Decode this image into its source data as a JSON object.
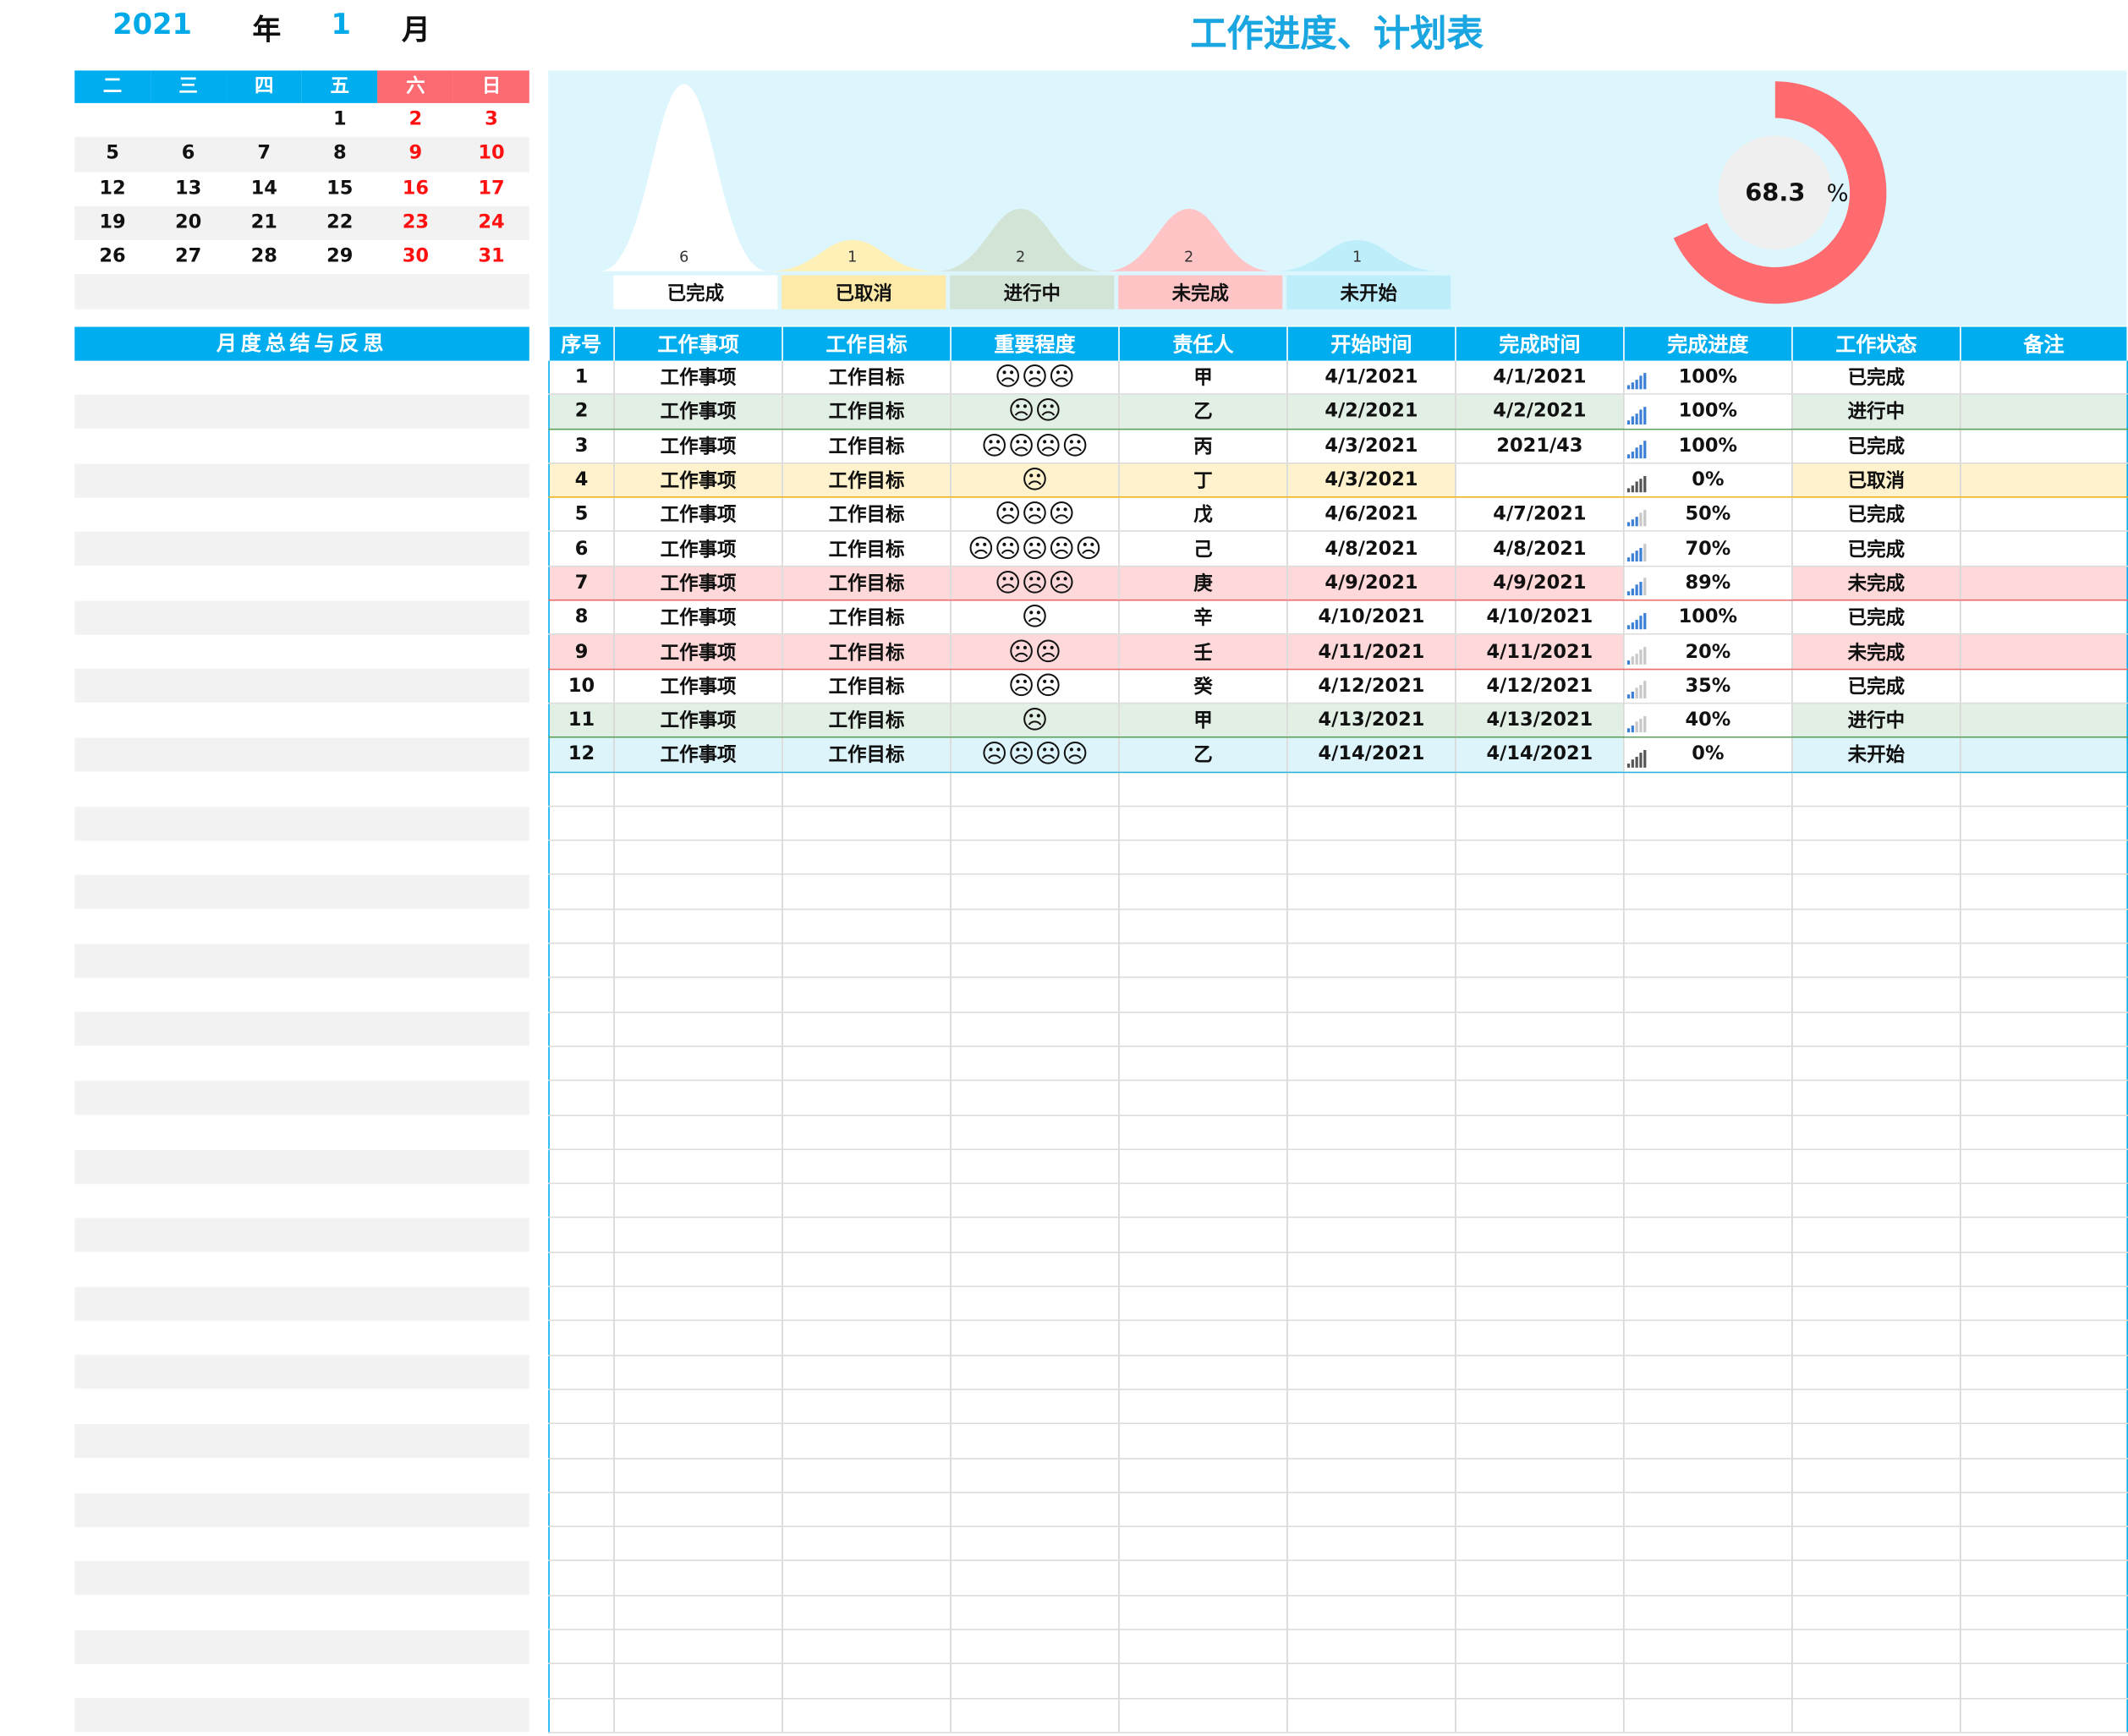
{
  "header": {
    "year": "2021",
    "year_unit": "年",
    "month": "1",
    "month_unit": "月",
    "title": "工作进度、计划表"
  },
  "calendar": {
    "weekdays": [
      "二",
      "三",
      "四",
      "五",
      "六",
      "日"
    ],
    "weeks": [
      [
        "",
        "",
        "",
        "1",
        "2",
        "3"
      ],
      [
        "5",
        "6",
        "7",
        "8",
        "9",
        "10"
      ],
      [
        "12",
        "13",
        "14",
        "15",
        "16",
        "17"
      ],
      [
        "19",
        "20",
        "21",
        "22",
        "23",
        "24"
      ],
      [
        "26",
        "27",
        "28",
        "29",
        "30",
        "31"
      ],
      [
        "",
        "",
        "",
        "",
        "",
        ""
      ]
    ],
    "weekend_color": "#ff1010",
    "header_color": "#00aeef",
    "weekend_header_color": "#fc6a72"
  },
  "summary": {
    "title": "月度总结与反思"
  },
  "dashboard": {
    "statuses": [
      {
        "label": "已完成",
        "count": "6",
        "color": "#ffffff",
        "label_bg": "#ffffff"
      },
      {
        "label": "已取消",
        "count": "1",
        "color": "#fff0b8",
        "label_bg": "#fde9a8"
      },
      {
        "label": "进行中",
        "count": "2",
        "color": "#d2e4d5",
        "label_bg": "#d2e4d5"
      },
      {
        "label": "未完成",
        "count": "2",
        "color": "#ffc4c6",
        "label_bg": "#ffc4c6"
      },
      {
        "label": "未开始",
        "count": "1",
        "color": "#bfeefb",
        "label_bg": "#bfeefb"
      }
    ],
    "completion": {
      "value_text": "68.3",
      "unit": "%",
      "fraction": 0.683,
      "ring_color": "#ff6b6f",
      "hole_color": "#efefef"
    }
  },
  "table": {
    "headers": [
      "序号",
      "工作事项",
      "工作目标",
      "重要程度",
      "责任人",
      "开始时间",
      "完成时间",
      "完成进度",
      "工作状态",
      "备注"
    ],
    "rows": [
      {
        "id": "1",
        "item": "工作事项",
        "goal": "工作目标",
        "importance": "☹☹☹",
        "owner": "甲",
        "start": "4/1/2021",
        "end": "4/1/2021",
        "progress": "100%",
        "progress_value": 1.0,
        "status": "已完成",
        "note": "",
        "row_class": "s-done"
      },
      {
        "id": "2",
        "item": "工作事项",
        "goal": "工作目标",
        "importance": "☹☹",
        "owner": "乙",
        "start": "4/2/2021",
        "end": "4/2/2021",
        "progress": "100%",
        "progress_value": 1.0,
        "status": "进行中",
        "note": "",
        "row_class": "s-prog"
      },
      {
        "id": "3",
        "item": "工作事项",
        "goal": "工作目标",
        "importance": "☹☹☹☹",
        "owner": "丙",
        "start": "4/3/2021",
        "end": "2021/43",
        "progress": "100%",
        "progress_value": 1.0,
        "status": "已完成",
        "note": "",
        "row_class": "s-done"
      },
      {
        "id": "4",
        "item": "工作事项",
        "goal": "工作目标",
        "importance": "☹",
        "owner": "丁",
        "start": "4/3/2021",
        "end": "",
        "progress": "0%",
        "progress_value": 0.0,
        "status": "已取消",
        "note": "",
        "row_class": "s-cancel"
      },
      {
        "id": "5",
        "item": "工作事项",
        "goal": "工作目标",
        "importance": "☹☹☹",
        "owner": "戊",
        "start": "4/6/2021",
        "end": "4/7/2021",
        "progress": "50%",
        "progress_value": 0.5,
        "status": "已完成",
        "note": "",
        "row_class": "s-done"
      },
      {
        "id": "6",
        "item": "工作事项",
        "goal": "工作目标",
        "importance": "☹☹☹☹☹",
        "owner": "己",
        "start": "4/8/2021",
        "end": "4/8/2021",
        "progress": "70%",
        "progress_value": 0.7,
        "status": "已完成",
        "note": "",
        "row_class": "s-done"
      },
      {
        "id": "7",
        "item": "工作事项",
        "goal": "工作目标",
        "importance": "☹☹☹",
        "owner": "庚",
        "start": "4/9/2021",
        "end": "4/9/2021",
        "progress": "89%",
        "progress_value": 0.89,
        "status": "未完成",
        "note": "",
        "row_class": "s-fail"
      },
      {
        "id": "8",
        "item": "工作事项",
        "goal": "工作目标",
        "importance": "☹",
        "owner": "辛",
        "start": "4/10/2021",
        "end": "4/10/2021",
        "progress": "100%",
        "progress_value": 1.0,
        "status": "已完成",
        "note": "",
        "row_class": "s-done"
      },
      {
        "id": "9",
        "item": "工作事项",
        "goal": "工作目标",
        "importance": "☹☹",
        "owner": "壬",
        "start": "4/11/2021",
        "end": "4/11/2021",
        "progress": "20%",
        "progress_value": 0.2,
        "status": "未完成",
        "note": "",
        "row_class": "s-fail"
      },
      {
        "id": "10",
        "item": "工作事项",
        "goal": "工作目标",
        "importance": "☹☹",
        "owner": "癸",
        "start": "4/12/2021",
        "end": "4/12/2021",
        "progress": "35%",
        "progress_value": 0.35,
        "status": "已完成",
        "note": "",
        "row_class": "s-done"
      },
      {
        "id": "11",
        "item": "工作事项",
        "goal": "工作目标",
        "importance": "☹",
        "owner": "甲",
        "start": "4/13/2021",
        "end": "4/13/2021",
        "progress": "40%",
        "progress_value": 0.4,
        "status": "进行中",
        "note": "",
        "row_class": "s-prog"
      },
      {
        "id": "12",
        "item": "工作事项",
        "goal": "工作目标",
        "importance": "☹☹☹☹",
        "owner": "乙",
        "start": "4/14/2021",
        "end": "4/14/2021",
        "progress": "0%",
        "progress_value": 0.0,
        "status": "未开始",
        "note": "",
        "row_class": "s-todo"
      }
    ],
    "header_color": "#00aeef"
  }
}
